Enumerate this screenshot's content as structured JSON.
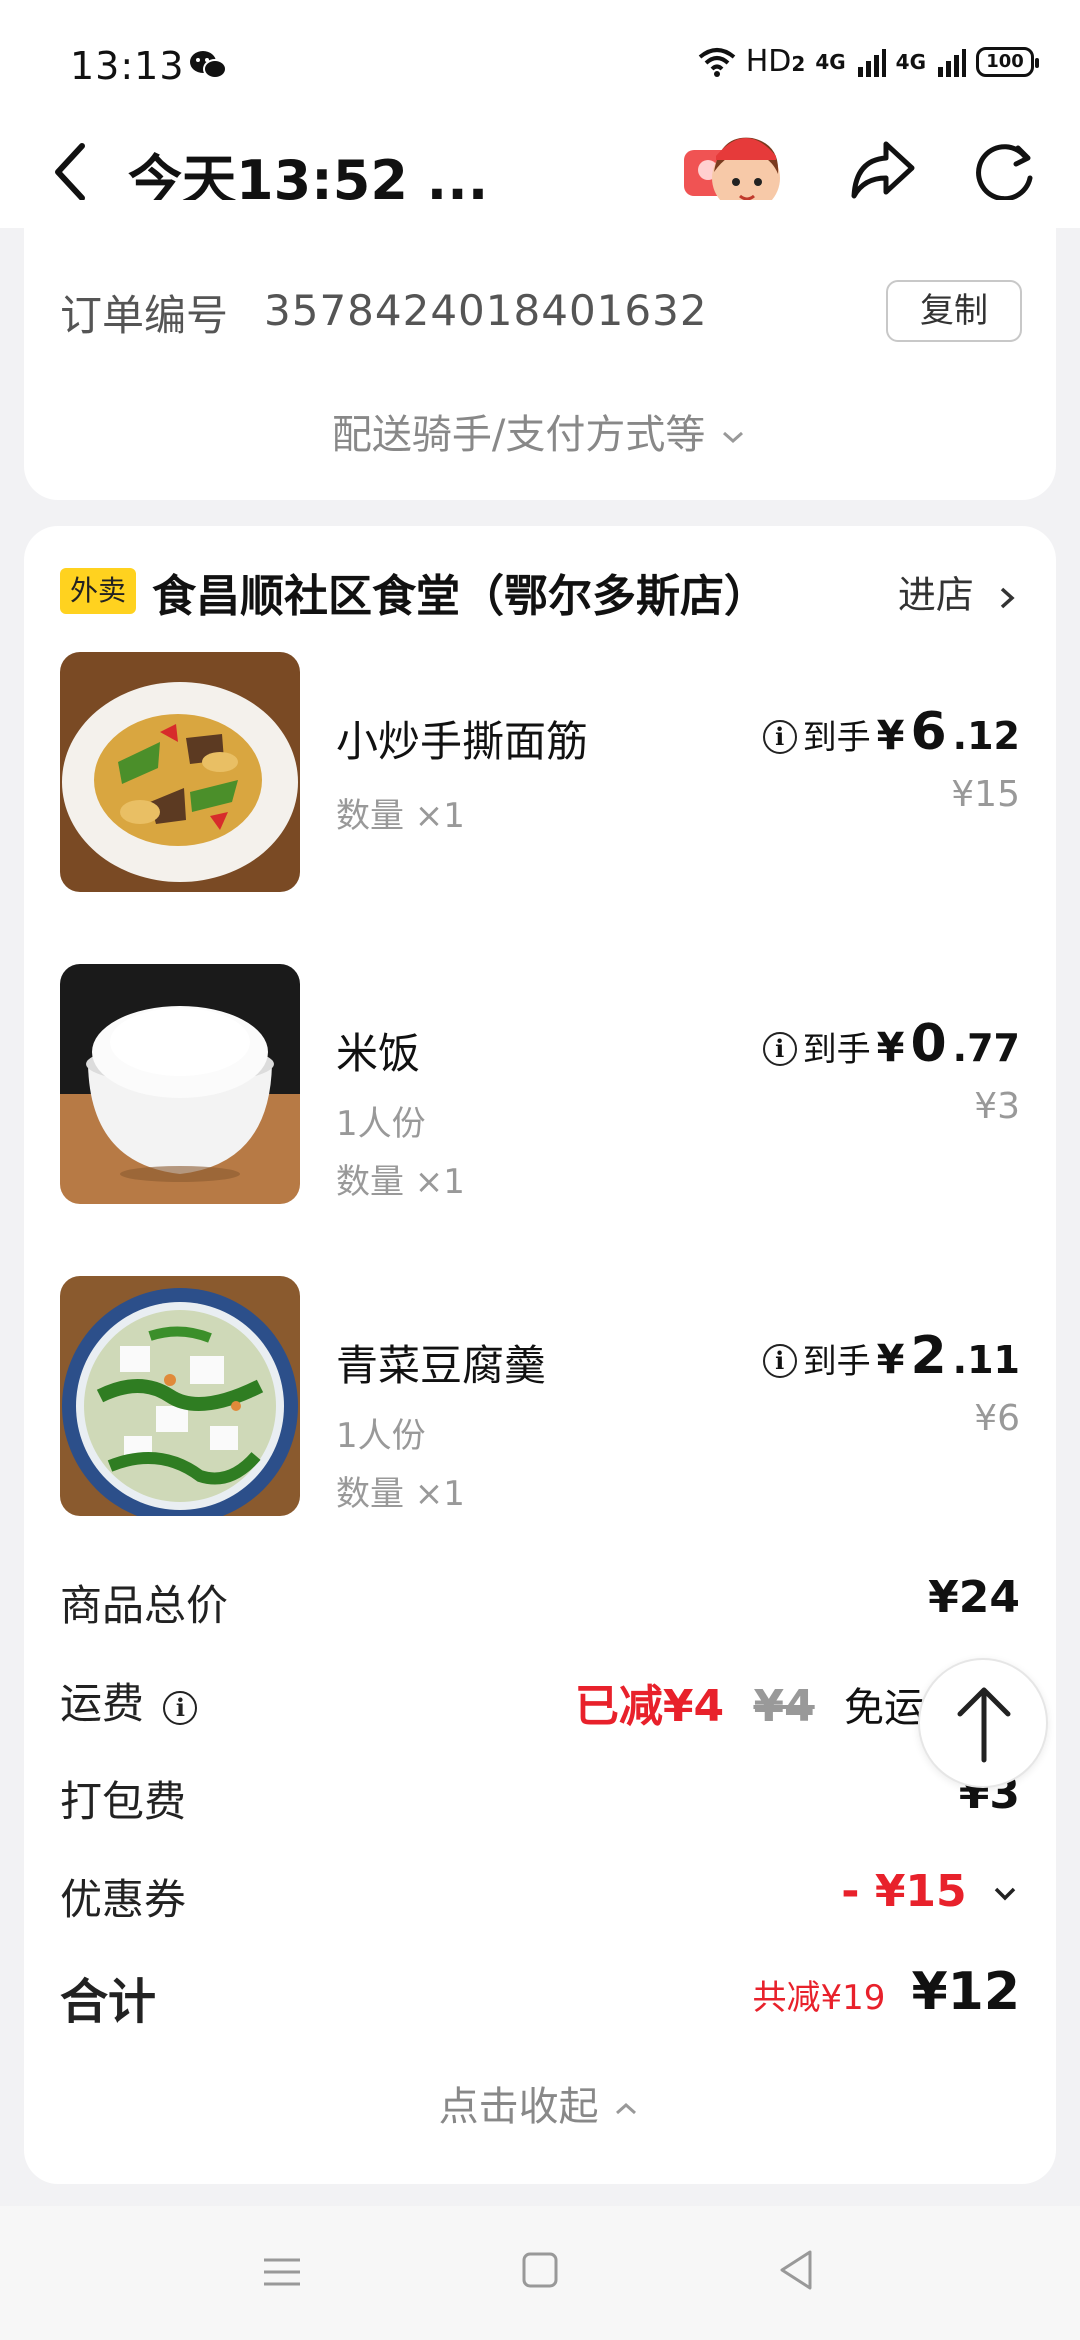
{
  "status_bar": {
    "time": "13:13",
    "network": "HD",
    "network_badge": "2",
    "signal1": "4G",
    "signal2": "4G",
    "battery": "100"
  },
  "nav": {
    "title": "今天13:52 ..."
  },
  "order": {
    "label": "订单编号",
    "number": "3578424018401632",
    "copy_label": "复制",
    "more_label": "配送骑手/支付方式等"
  },
  "store": {
    "tag": "外卖",
    "name": "食昌顺社区食堂（鄂尔多斯店）",
    "enter_label": "进店"
  },
  "items": [
    {
      "name": "小炒手撕面筋",
      "sub1": "",
      "qty": "数量 ×1",
      "daoshou": "到手",
      "price_int": "6",
      "price_dec": ".12",
      "orig": "¥15"
    },
    {
      "name": "米饭",
      "sub1": "1人份",
      "qty": "数量 ×1",
      "daoshou": "到手",
      "price_int": "0",
      "price_dec": ".77",
      "orig": "¥3"
    },
    {
      "name": "青菜豆腐羹",
      "sub1": "1人份",
      "qty": "数量 ×1",
      "daoshou": "到手",
      "price_int": "2",
      "price_dec": ".11",
      "orig": "¥6"
    }
  ],
  "summary": {
    "goods_total_label": "商品总价",
    "goods_total": "¥24",
    "delivery_label": "运费",
    "delivery_reduced": "已减¥4",
    "delivery_orig": "¥4",
    "delivery_free": "免运费",
    "packing_label": "打包费",
    "packing_value": "¥3",
    "coupon_label": "优惠券",
    "coupon_value": "- ¥15",
    "total_label": "合计",
    "total_saved": "共减¥19",
    "total_value": "¥12",
    "collapse_label": "点击收起"
  },
  "colors": {
    "accent_red": "#e8212b",
    "tag_yellow": "#ffd21f"
  }
}
